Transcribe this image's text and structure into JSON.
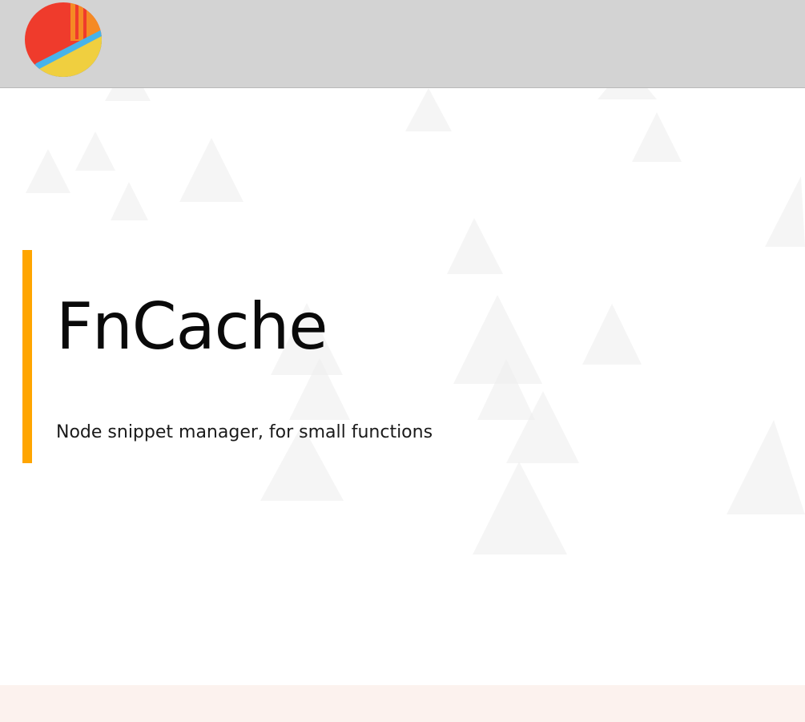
{
  "header": {
    "logo_icon": "fncache-logo-icon"
  },
  "hero": {
    "title": "FnCache",
    "tagline": "Node snippet manager, for small functions"
  },
  "colors": {
    "header_background": "#d3d3d3",
    "accent": "#ffa500",
    "footer_band": "#fcf2ee",
    "background_shape": "#ececec",
    "logo_red": "#ef3b2c",
    "logo_orange": "#f58a24",
    "logo_yellow": "#f0cf3f",
    "logo_blue": "#47b3ea"
  },
  "background": {
    "decoration": "triangle-pattern"
  }
}
